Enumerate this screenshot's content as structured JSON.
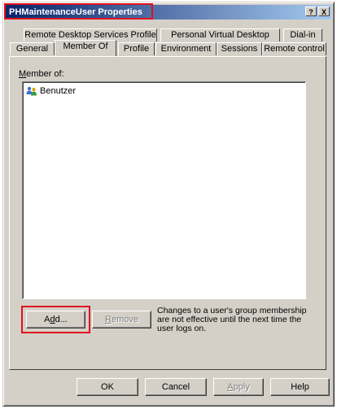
{
  "window": {
    "title": "PHMaintenanceUser Properties",
    "help_glyph": "?",
    "close_glyph": "X"
  },
  "tabs_row1": [
    {
      "label": "Remote Desktop Services Profile"
    },
    {
      "label": "Personal Virtual Desktop"
    },
    {
      "label": "Dial-in"
    }
  ],
  "tabs_row2": [
    {
      "label": "General"
    },
    {
      "label": "Member Of",
      "active": true
    },
    {
      "label": "Profile"
    },
    {
      "label": "Environment"
    },
    {
      "label": "Sessions"
    },
    {
      "label": "Remote control"
    }
  ],
  "member_of": {
    "label_first": "M",
    "label_rest": "ember of:",
    "items": [
      {
        "name": "Benutzer",
        "icon": "group-icon"
      }
    ]
  },
  "buttons": {
    "add_pre": "A",
    "add_u": "d",
    "add_post": "d...",
    "remove_u": "R",
    "remove_rest": "emove",
    "note": "Changes to a user's group membership are not effective until the next time the user logs on.",
    "ok": "OK",
    "cancel": "Cancel",
    "apply_u": "A",
    "apply_rest": "pply",
    "help": "Help"
  },
  "colors": {
    "title_gradient_start": "#0a246a",
    "title_gradient_end": "#a6caf0",
    "highlight": "#e0101e",
    "dialog_face": "#d4d0c8"
  }
}
